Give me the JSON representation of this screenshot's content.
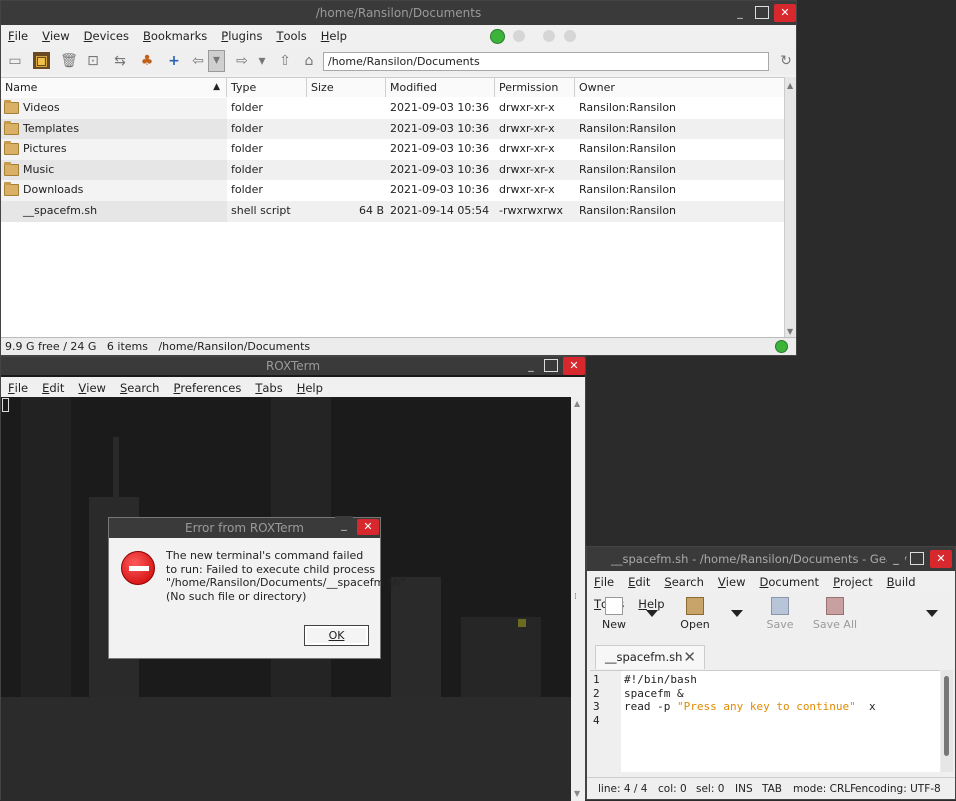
{
  "spacefm": {
    "title": "/home/Ransilon/Documents",
    "menu": [
      "File",
      "View",
      "Devices",
      "Bookmarks",
      "Plugins",
      "Tools",
      "Help"
    ],
    "path": "/home/Ransilon/Documents",
    "columns": [
      "Name",
      "Type",
      "Size",
      "Modified",
      "Permission",
      "Owner"
    ],
    "rows": [
      {
        "name": "Videos",
        "type": "folder",
        "size": "",
        "modified": "2021-09-03 10:36",
        "perm": "drwxr-xr-x",
        "owner": "Ransilon:Ransilon",
        "icon": "folder-icon"
      },
      {
        "name": "Templates",
        "type": "folder",
        "size": "",
        "modified": "2021-09-03 10:36",
        "perm": "drwxr-xr-x",
        "owner": "Ransilon:Ransilon",
        "icon": "folder-icon"
      },
      {
        "name": "Pictures",
        "type": "folder",
        "size": "",
        "modified": "2021-09-03 10:36",
        "perm": "drwxr-xr-x",
        "owner": "Ransilon:Ransilon",
        "icon": "folder-icon"
      },
      {
        "name": "Music",
        "type": "folder",
        "size": "",
        "modified": "2021-09-03 10:36",
        "perm": "drwxr-xr-x",
        "owner": "Ransilon:Ransilon",
        "icon": "folder-icon"
      },
      {
        "name": "Downloads",
        "type": "folder",
        "size": "",
        "modified": "2021-09-03 10:36",
        "perm": "drwxr-xr-x",
        "owner": "Ransilon:Ransilon",
        "icon": "folder-icon"
      },
      {
        "name": "__spacefm.sh",
        "type": "shell script",
        "size": "64 B",
        "modified": "2021-09-14 05:54",
        "perm": "-rwxrwxrwx",
        "owner": "Ransilon:Ransilon",
        "icon": "file-icon"
      }
    ],
    "status": "9.9 G free / 24 G   6 items   /home/Ransilon/Documents"
  },
  "roxterm": {
    "title": "ROXTerm",
    "menu": [
      "File",
      "Edit",
      "View",
      "Search",
      "Preferences",
      "Tabs",
      "Help"
    ]
  },
  "dialog": {
    "title": "Error from ROXTerm",
    "message": "The new terminal's command failed to run: Failed to execute child process \"/home/Ransilon/Documents/__spacefm.sh\" (No such file or directory)",
    "ok": "OK"
  },
  "geany": {
    "title": "__spacefm.sh - /home/Ransilon/Documents - Geany",
    "menu": [
      "File",
      "Edit",
      "Search",
      "View",
      "Document",
      "Project",
      "Build",
      "Tools",
      "Help"
    ],
    "toolbar": {
      "new": "New",
      "open": "Open",
      "save": "Save",
      "save_all": "Save All"
    },
    "tab": "__spacefm.sh",
    "lines": [
      "1",
      "2",
      "3",
      "4"
    ],
    "code": {
      "l1": "#!/bin/bash",
      "l2": "spacefm &",
      "l3a": "read -p ",
      "l3b": "\"Press any key to continue\"",
      "l3c": "  x"
    },
    "status": {
      "line": "line: 4 / 4",
      "col": "col: 0",
      "sel": "sel: 0",
      "ins": "INS",
      "tab": "TAB",
      "mode": "mode: CRLF",
      "enc": "encoding: UTF-8"
    }
  }
}
